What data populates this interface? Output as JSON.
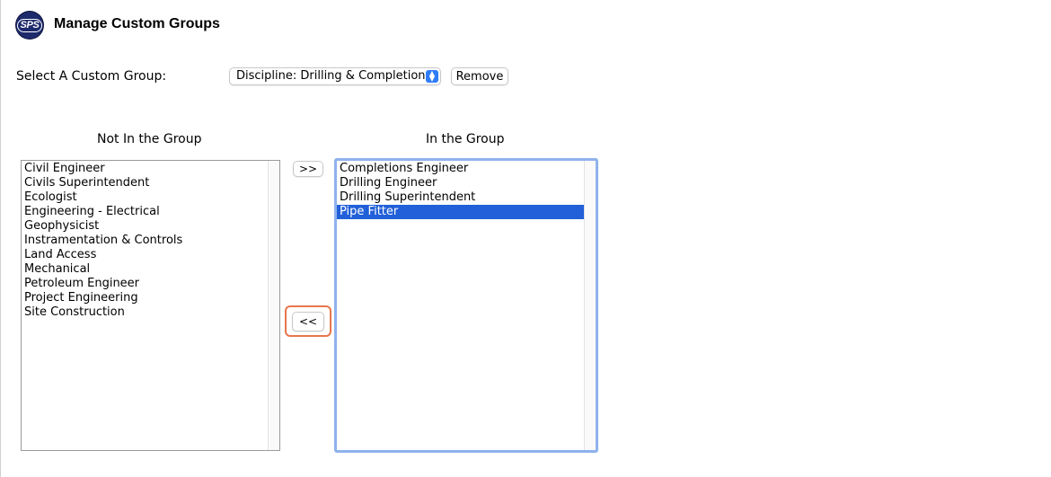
{
  "header": {
    "logo_text": "SPS",
    "title": "Manage Custom Groups"
  },
  "group_select": {
    "label": "Select A Custom Group:",
    "selected": "Discipline: Drilling & Completions",
    "remove_label": "Remove"
  },
  "not_in_group": {
    "heading": "Not In the Group",
    "items": [
      "Civil Engineer",
      "Civils Superintendent",
      "Ecologist",
      "Engineering - Electrical",
      "Geophysicist",
      "Instramentation & Controls",
      "Land Access",
      "Mechanical",
      "Petroleum Engineer",
      "Project Engineering",
      "Site Construction"
    ]
  },
  "in_group": {
    "heading": "In the Group",
    "items": [
      "Completions Engineer",
      "Drilling Engineer",
      "Drilling Superintendent",
      "Pipe Fitter"
    ],
    "selected_index": 3
  },
  "transfer": {
    "add_label": ">>",
    "remove_label": "<<"
  },
  "colors": {
    "selection": "#2160d8",
    "focus_ring": "#8eb2ec",
    "highlight": "#e8764b",
    "logo": "#1d2a6b"
  }
}
